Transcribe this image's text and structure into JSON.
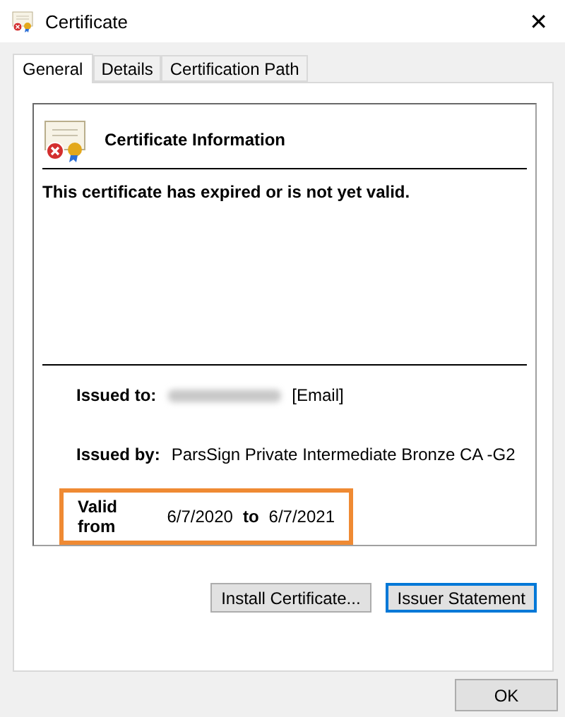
{
  "window": {
    "title": "Certificate",
    "close": "✕"
  },
  "tabs": [
    {
      "label": "General",
      "selected": true
    },
    {
      "label": "Details",
      "selected": false
    },
    {
      "label": "Certification Path",
      "selected": false
    }
  ],
  "info": {
    "heading": "Certificate Information",
    "status": "This certificate has expired or is not yet valid.",
    "invalid": true
  },
  "issued_to": {
    "label": "Issued to:",
    "redacted": true,
    "value": "[Email]"
  },
  "issued_by": {
    "label": "Issued by:",
    "value": "ParsSign Private Intermediate Bronze CA -G2"
  },
  "validity": {
    "label": "Valid from",
    "from": "6/7/2020",
    "to_word": "to",
    "to": "6/7/2021",
    "highlighted": true
  },
  "buttons": [
    {
      "label": "Install Certificate...",
      "focused": false
    },
    {
      "label": "Issuer Statement",
      "focused": true
    }
  ],
  "footer_buttons": [
    {
      "label": "OK",
      "focused": false
    }
  ]
}
